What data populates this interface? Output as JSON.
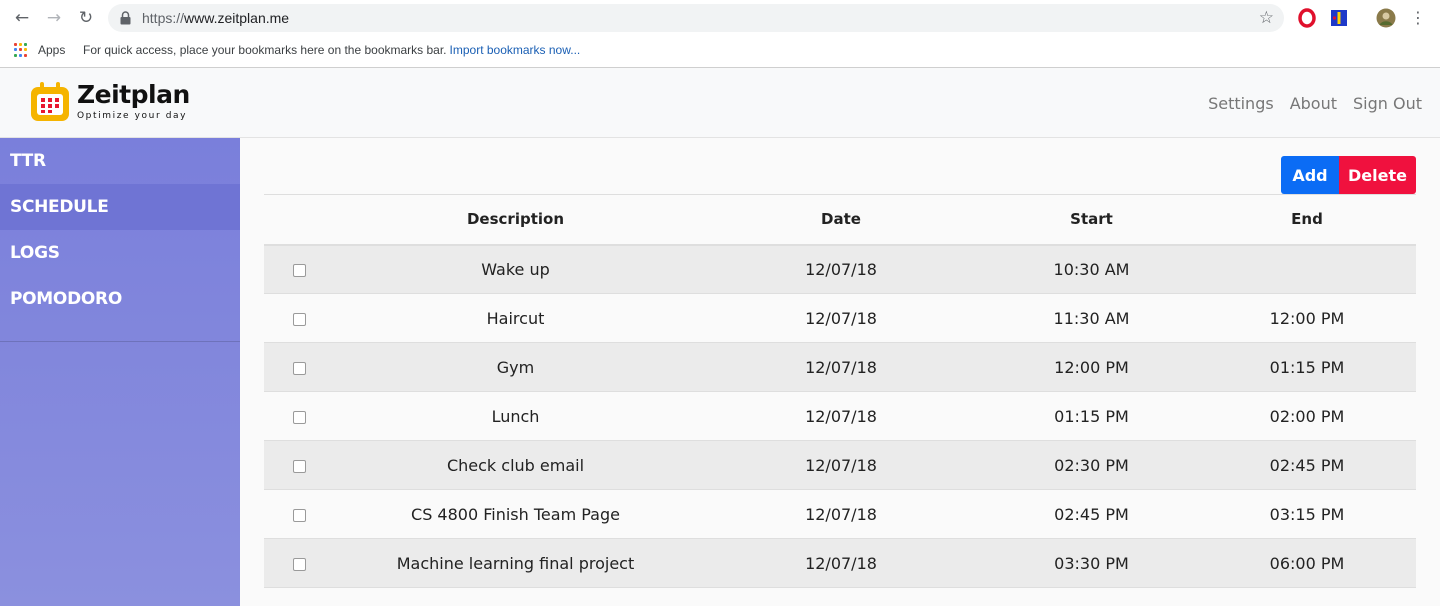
{
  "browser": {
    "url_scheme": "https://",
    "url_host": "www.zeitplan.me",
    "bookmarks_apps": "Apps",
    "bookmarks_hint": "For quick access, place your bookmarks here on the bookmarks bar.",
    "bookmarks_import": "Import bookmarks now..."
  },
  "app": {
    "name": "Zeitplan",
    "tagline": "Optimize your day",
    "nav": [
      "Settings",
      "About",
      "Sign Out"
    ]
  },
  "sidebar": {
    "items": [
      "TTR",
      "SCHEDULE",
      "LOGS",
      "POMODORO"
    ],
    "active": "SCHEDULE"
  },
  "actions": {
    "add": "Add",
    "delete": "Delete"
  },
  "schedule": {
    "columns": [
      "Description",
      "Date",
      "Start",
      "End"
    ],
    "rows": [
      {
        "description": "Wake up",
        "date": "12/07/18",
        "start": "10:30 AM",
        "end": ""
      },
      {
        "description": "Haircut",
        "date": "12/07/18",
        "start": "11:30 AM",
        "end": "12:00 PM"
      },
      {
        "description": "Gym",
        "date": "12/07/18",
        "start": "12:00 PM",
        "end": "01:15 PM"
      },
      {
        "description": "Lunch",
        "date": "12/07/18",
        "start": "01:15 PM",
        "end": "02:00 PM"
      },
      {
        "description": "Check club email",
        "date": "12/07/18",
        "start": "02:30 PM",
        "end": "02:45 PM"
      },
      {
        "description": "CS 4800 Finish Team Page",
        "date": "12/07/18",
        "start": "02:45 PM",
        "end": "03:15 PM"
      },
      {
        "description": "Machine learning final project",
        "date": "12/07/18",
        "start": "03:30 PM",
        "end": "06:00 PM"
      }
    ]
  },
  "colors": {
    "sidebar": "#7a7fdb",
    "sidebar_active": "#6f74d4",
    "add_button": "#0b6cf5",
    "delete_button": "#f0113e",
    "logo_accent": "#f5b400"
  },
  "icons": [
    "back-arrow-icon",
    "forward-arrow-icon",
    "reload-icon",
    "lock-icon",
    "bookmark-star-icon",
    "opera-extension-icon",
    "extension-icon",
    "profile-avatar-icon",
    "menu-dots-icon",
    "apps-grid-icon",
    "calendar-logo-icon"
  ]
}
